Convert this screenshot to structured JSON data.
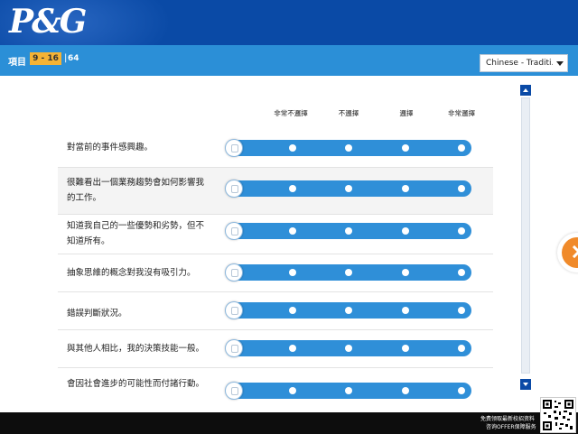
{
  "header": {
    "logo_text": "P&G"
  },
  "subbar": {
    "item_label": "項目",
    "range": "9 - 16",
    "separator": "|",
    "total": "64"
  },
  "language": {
    "selected": "Chinese - Traditi..."
  },
  "scale": {
    "labels": [
      "非常不邏擇",
      "不邏擇",
      "邏擇",
      "非常邏擇"
    ]
  },
  "questions": [
    {
      "text": "對當前的事件感興趣。"
    },
    {
      "text": "很難看出一個業務趨勢會如何影響我的工作。"
    },
    {
      "text": "知道我自己的一些優勢和劣勢，但不知道所有。"
    },
    {
      "text": "抽象思維的概念對我沒有吸引力。"
    },
    {
      "text": "錯誤判斷狀況。"
    },
    {
      "text": "與其他人相比，我的決策技能一般。"
    },
    {
      "text": "會因社會進步的可能性而付諸行動。"
    }
  ],
  "footer": {
    "ad_line1": "免费领取最新校招资料",
    "ad_line2": "咨询OFFER保障服务"
  },
  "colors": {
    "header_bg": "#0a4aa6",
    "subbar_bg": "#2b8fd7",
    "track": "#2f8fd8",
    "badge": "#f5b335",
    "next_button": "#f08a2a"
  },
  "icons": {
    "next": "chevron-right-icon",
    "language_dropdown": "caret-down-icon",
    "scroll_up": "arrow-up-icon",
    "scroll_down": "arrow-down-icon",
    "handle": "slider-handle-icon"
  }
}
